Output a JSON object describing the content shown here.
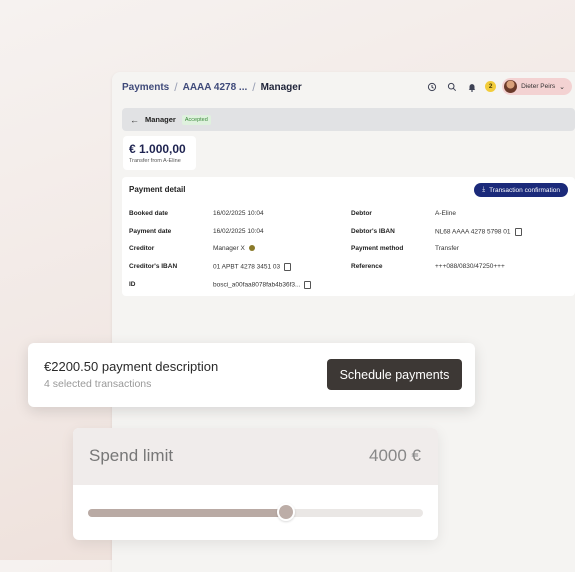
{
  "breadcrumb": [
    "Payments",
    "AAAA 4278 ...",
    "Manager"
  ],
  "topbar": {
    "notification_count": "2",
    "user_name": "Dieter Peirs"
  },
  "manager": {
    "title": "Manager",
    "status": "Accepted"
  },
  "amount": {
    "value": "€ 1.000,00",
    "subtitle": "Transfer from A-Eline"
  },
  "detail": {
    "title": "Payment detail",
    "confirm_button": "Transaction confirmation",
    "left": [
      {
        "label": "Booked date",
        "value": "16/02/2025 10:04"
      },
      {
        "label": "Payment date",
        "value": "16/02/2025 10:04"
      },
      {
        "label": "Creditor",
        "value": "Manager X"
      },
      {
        "label": "Creditor's IBAN",
        "value": "01 APBT 4278 3451 03"
      },
      {
        "label": "ID",
        "value": "bosci_a00faa8078fab4b36f3..."
      }
    ],
    "right": [
      {
        "label": "Debtor",
        "value": "A-Eline"
      },
      {
        "label": "Debtor's IBAN",
        "value": "NL68 AAAA 4278 5798 01"
      },
      {
        "label": "Payment method",
        "value": "Transfer"
      },
      {
        "label": "Reference",
        "value": "+++088/0830/47250+++"
      }
    ]
  },
  "schedule": {
    "title": "€2200.50 payment description",
    "subtitle": "4 selected transactions",
    "button": "Schedule payments"
  },
  "spend": {
    "label": "Spend limit",
    "value": "4000 €",
    "slider_fraction": 0.59
  },
  "colors": {
    "primary": "#1b2a7a",
    "dark_button": "#3d3835",
    "accepted": "#3a8a3a"
  },
  "icons": [
    "arrow-left-icon",
    "history-icon",
    "search-icon",
    "bell-icon",
    "chevron-down-icon",
    "copy-icon",
    "download-icon",
    "info-icon"
  ]
}
